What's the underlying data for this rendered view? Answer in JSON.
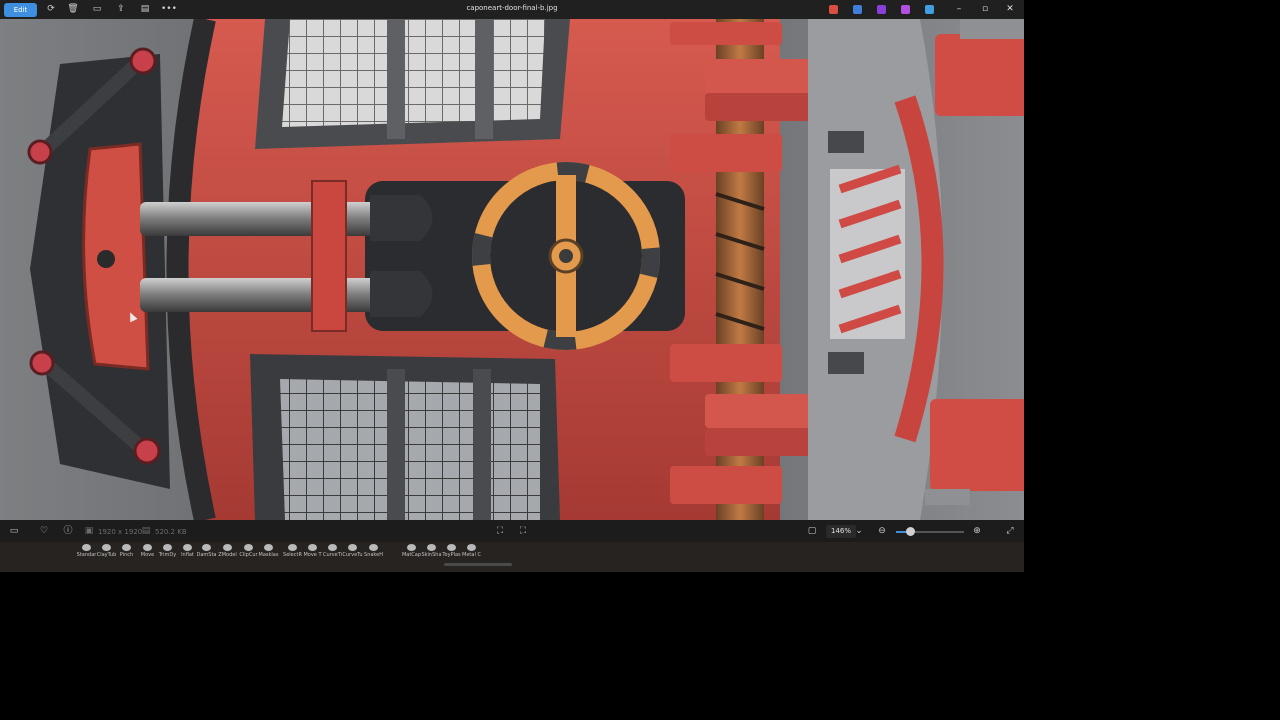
{
  "titlebar": {
    "edit_label": "Edit",
    "title": "caponeart-door-final-b.jpg",
    "more_icon": "more-icon",
    "minimize": "–",
    "maximize": "▫",
    "close": "✕"
  },
  "statusbar": {
    "dimensions": "1920 x 1920",
    "filesize": "520.2 KB",
    "zoom": "146%",
    "zoom_level": 0.22
  },
  "brushes": [
    "Standar",
    "ClayTub",
    "Pinch",
    "Move",
    "TrimDy",
    "Inflat",
    "DamSta",
    "ZModel",
    "ClipCur",
    "Masklas",
    "SelectR",
    "Move T",
    "CurveTi",
    "CurveTu",
    "SnakeH",
    "MatCap",
    "SkinSha",
    "ToyPlas",
    "Metal C"
  ],
  "colors": {
    "accent": "#3f8fe0",
    "door_red": "#c9463f",
    "door_orange": "#e49a4c",
    "background": "#6e7074"
  }
}
